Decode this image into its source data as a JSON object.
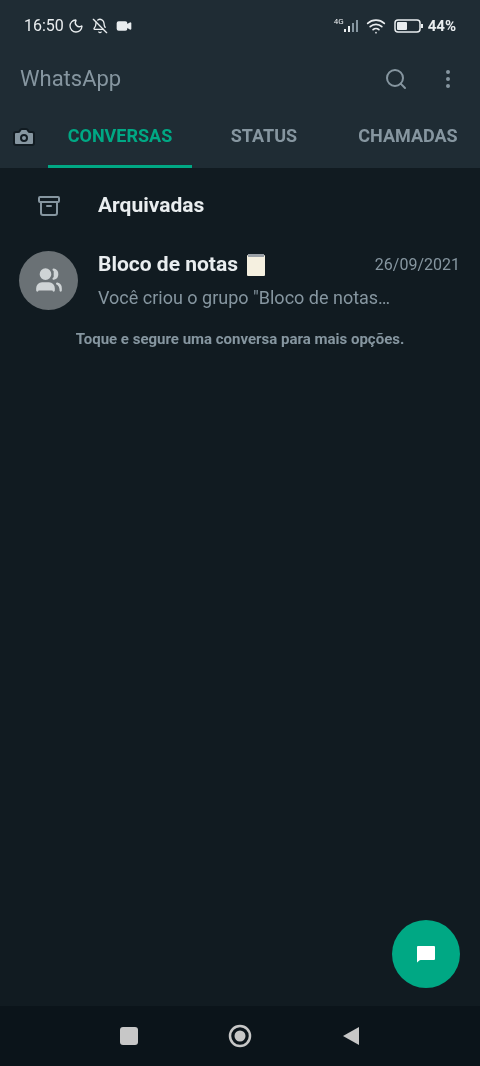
{
  "status_bar": {
    "time": "16:50",
    "network": "4G",
    "battery": "44%"
  },
  "app_bar": {
    "title": "WhatsApp"
  },
  "tabs": [
    {
      "label": "CONVERSAS",
      "selected": true
    },
    {
      "label": "STATUS",
      "selected": false
    },
    {
      "label": "CHAMADAS",
      "selected": false
    }
  ],
  "archived": {
    "label": "Arquivadas"
  },
  "chats": [
    {
      "name": "Bloco de notas",
      "date": "26/09/2021",
      "preview": "Você criou o grupo \"Bloco de notas…"
    }
  ],
  "hint": "Toque e segure uma conversa para mais opções."
}
